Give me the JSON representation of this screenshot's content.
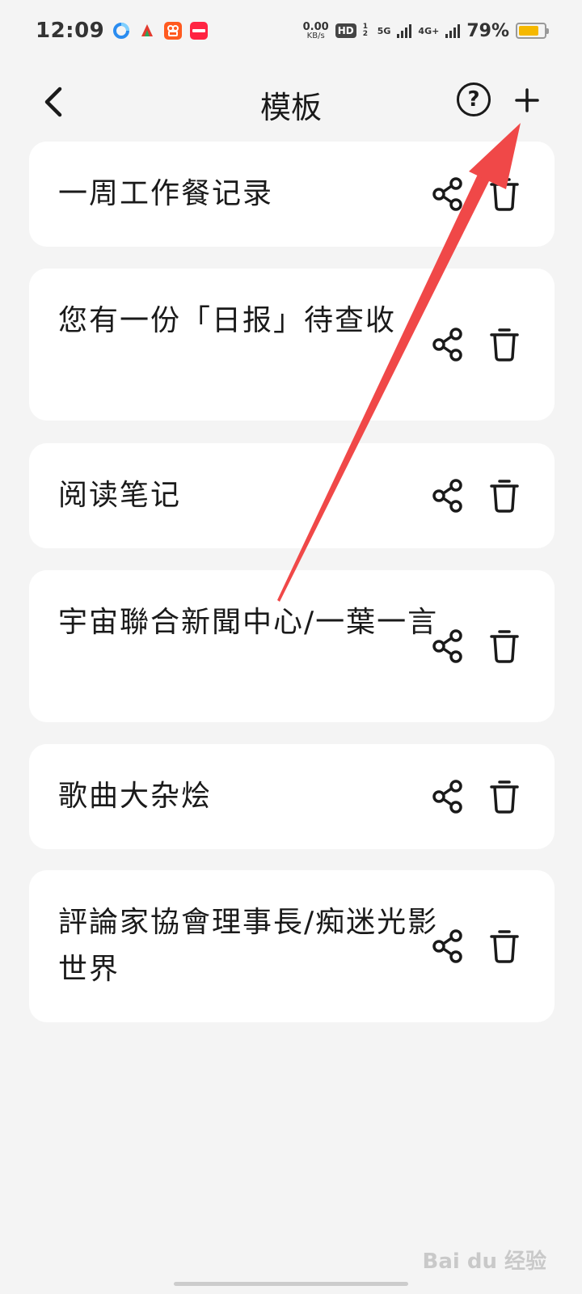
{
  "status_bar": {
    "time": "12:09",
    "net_speed": "0.00",
    "net_unit": "KB/s",
    "hd": "HD",
    "sim_slots": "1 2",
    "net_5g": "5G",
    "net_4g": "4G+",
    "battery_percent": "79%",
    "battery_level": 0.79,
    "battery_color": "#f5b800"
  },
  "header": {
    "title": "模板",
    "help_label": "?"
  },
  "templates": [
    {
      "title": "一周工作餐记录"
    },
    {
      "title": "您有一份「日报」待查收"
    },
    {
      "title": "阅读笔记"
    },
    {
      "title": "宇宙聯合新聞中心/一葉一言"
    },
    {
      "title": "歌曲大杂烩"
    },
    {
      "title": "評論家協會理事長/痴迷光影世界"
    }
  ],
  "annotation": {
    "arrow_color": "#f04848"
  },
  "watermark": "Bai du 经验"
}
